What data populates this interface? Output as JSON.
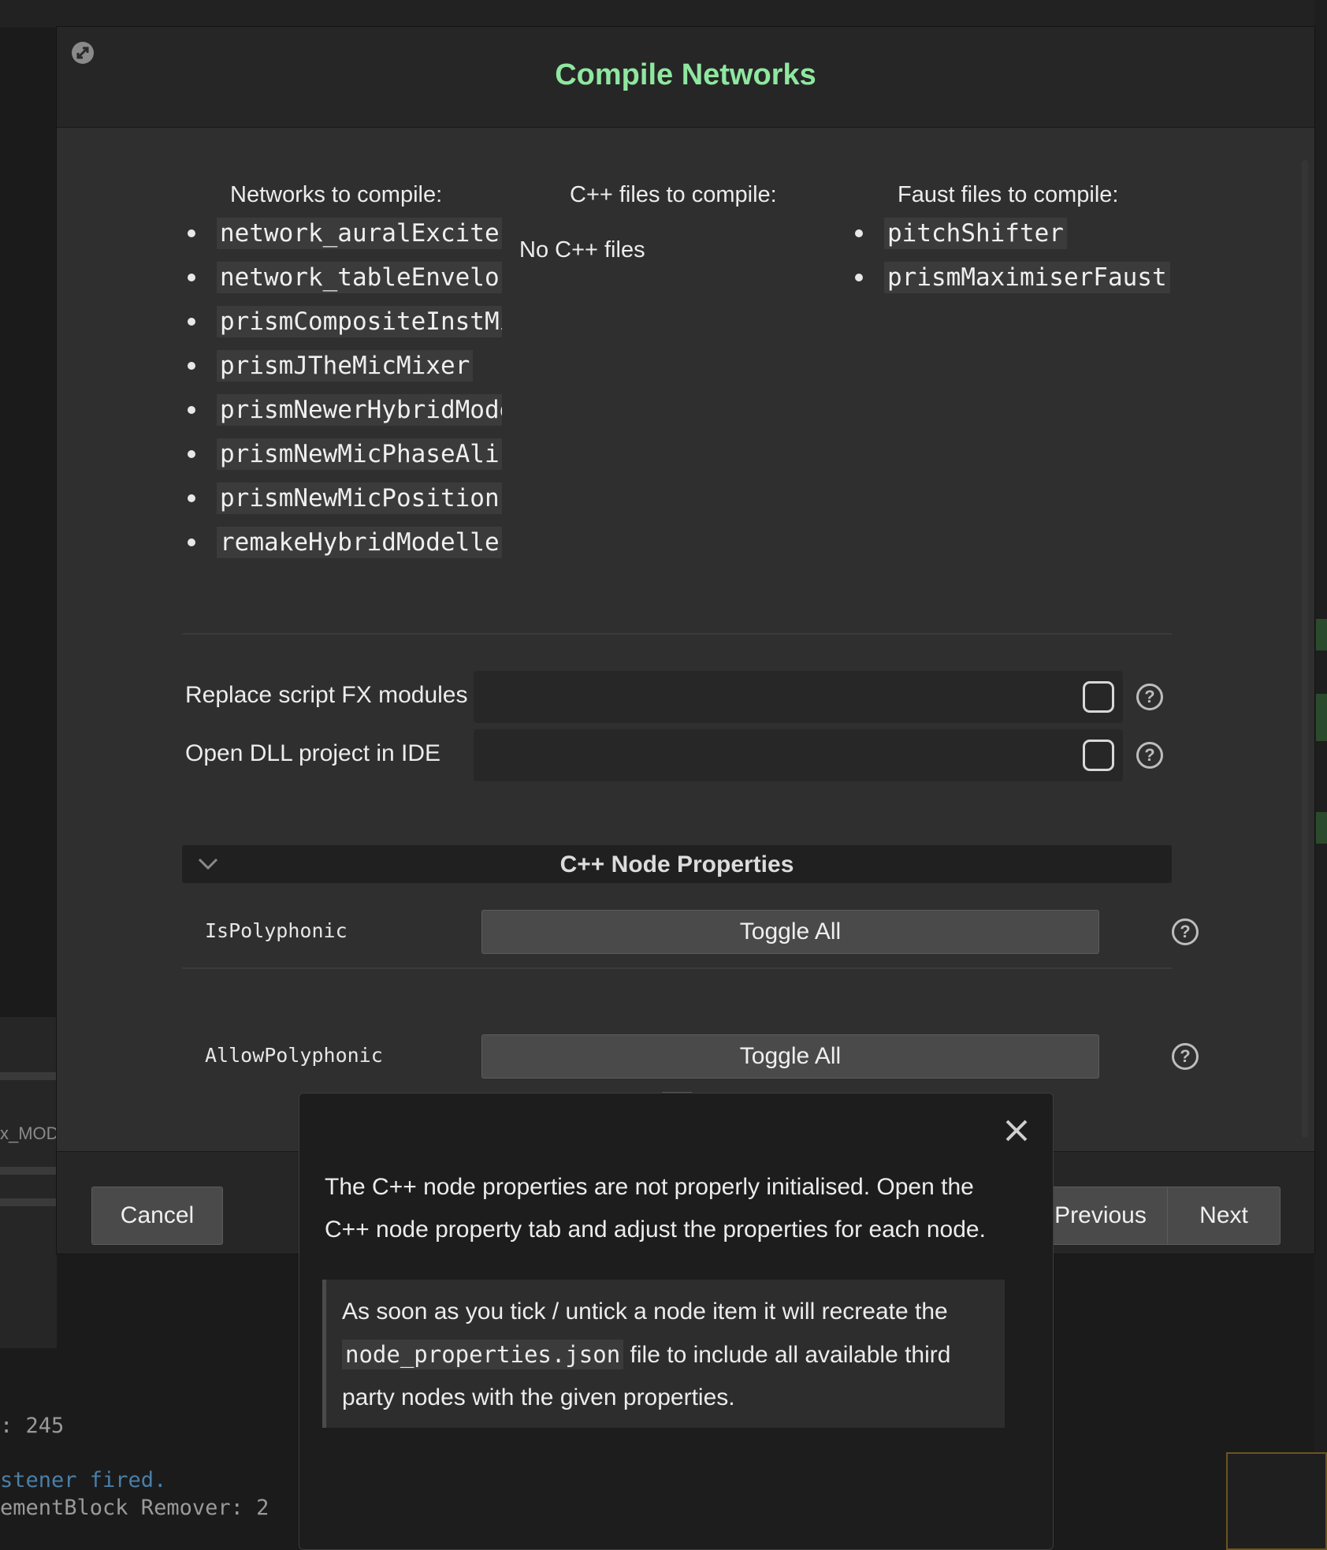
{
  "dialog": {
    "title": "Compile Networks"
  },
  "columns": {
    "networks": {
      "heading": "Networks to compile:",
      "items": [
        "network_auralExcite",
        "network_tableEnvelo",
        "prismCompositeInstMi",
        "prismJTheMicMixer",
        "prismNewerHybridMode",
        "prismNewMicPhaseAli",
        "prismNewMicPosition",
        "remakeHybridModelle"
      ]
    },
    "cpp": {
      "heading": "C++ files to compile:",
      "empty_text": "No C++ files"
    },
    "faust": {
      "heading": "Faust files to compile:",
      "items": [
        "pitchShifter",
        "prismMaximiserFaust"
      ]
    }
  },
  "options": [
    {
      "label": "Replace script FX modules",
      "checked": false
    },
    {
      "label": "Open DLL project in IDE",
      "checked": false
    }
  ],
  "cpp_node_properties": {
    "title": "C++ Node Properties",
    "rows": [
      {
        "name": "IsPolyphonic",
        "button": "Toggle All"
      },
      {
        "name": "AllowPolyphonic",
        "button": "Toggle All"
      }
    ]
  },
  "footer": {
    "cancel": "Cancel",
    "previous": "Previous",
    "next": "Next"
  },
  "popup": {
    "message": "The C++ node properties are not properly initialised. Open the C++ node property tab and adjust the properties for each node.",
    "note_before": "As soon as you tick / untick a node item it will recreate the",
    "note_code": "node_properties.json",
    "note_after": "file to include all available third party nodes with the given properties."
  },
  "background": {
    "console_line_1": ": 245",
    "console_line_2": "stener fired.",
    "console_line_3": "ementBlock Remover: 2",
    "module_label": "x_MOD"
  },
  "colors": {
    "title_accent": "#8fe7a0",
    "dialog_bg": "#2f2f2f",
    "popup_bg": "#1d1d1d"
  }
}
